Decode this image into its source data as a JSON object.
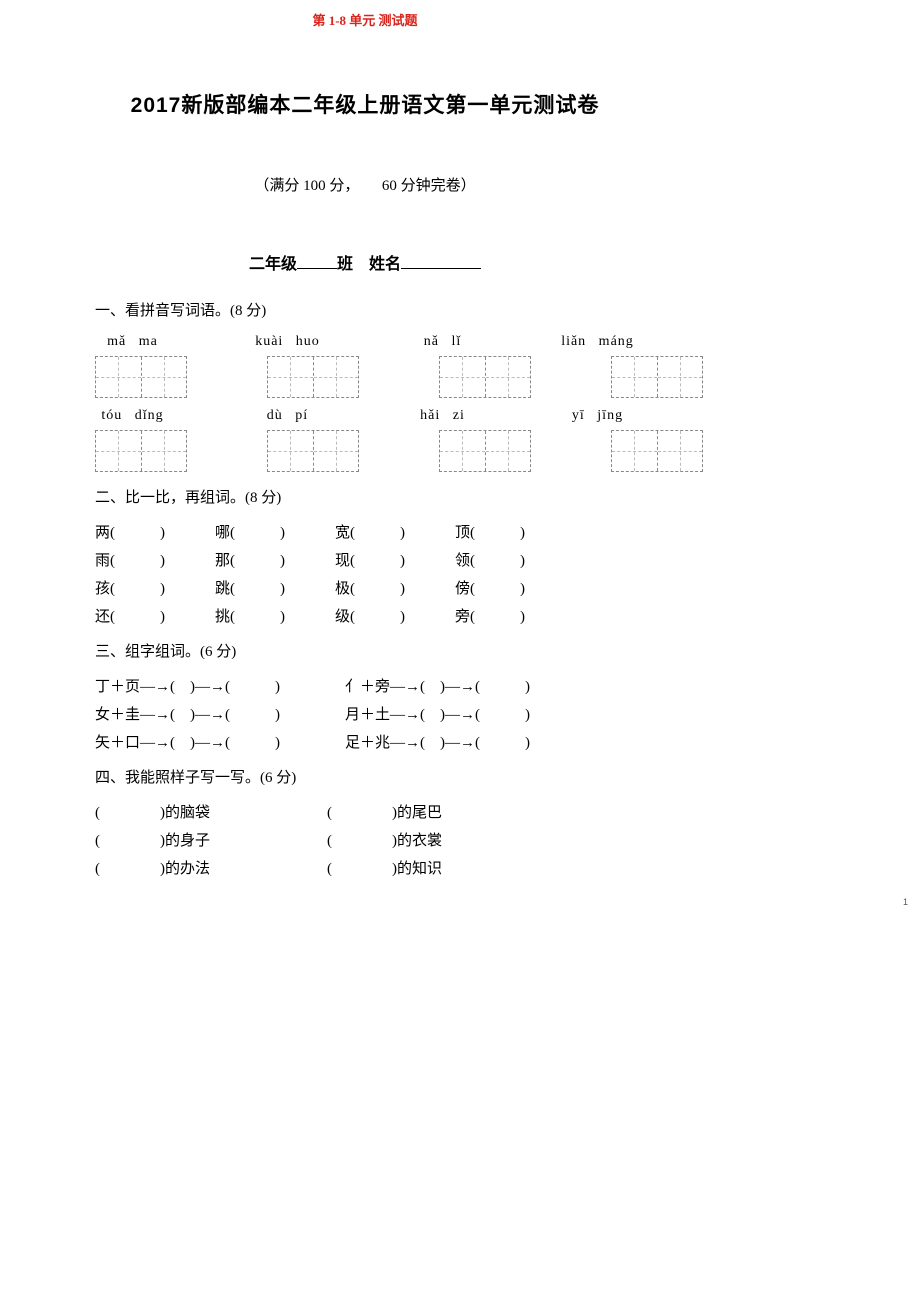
{
  "header_note": "第 1-8 单元 测试题",
  "title": "2017新版部编本二年级上册语文第一单元测试卷",
  "subtitle_left": "（满分 100 分，",
  "subtitle_right": "60 分钟完卷）",
  "name_line": {
    "part1": "二年级",
    "part2": "班　姓名"
  },
  "sections": {
    "s1": "一、看拼音写词语。(8 分)",
    "s2": "二、比一比，再组词。(8 分)",
    "s3": "三、组字组词。(6 分)",
    "s4": "四、我能照样子写一写。(6 分)"
  },
  "pinyin_rows": [
    [
      "mǎ ma",
      "kuài huo",
      "nǎ   lǐ",
      "liǎn máng"
    ],
    [
      "tóu dǐng",
      "dù   pí",
      "hǎi   zi",
      "yī   jīng"
    ]
  ],
  "compare_rows": [
    [
      "两(　　　)",
      "哪(　　　)",
      "宽(　　　)",
      "顶(　　　)"
    ],
    [
      "雨(　　　)",
      "那(　　　)",
      "现(　　　)",
      "领(　　　)"
    ],
    [
      "孩(　　　)",
      "跳(　　　)",
      "极(　　　)",
      "傍(　　　)"
    ],
    [
      "还(　　　)",
      "挑(　　　)",
      "级(　　　)",
      "旁(　　　)"
    ]
  ],
  "compose_rows": [
    {
      "left": "丁＋页—→(　)—→(　　　)",
      "right": "亻＋旁—→(　)—→(　　　)"
    },
    {
      "left": "女＋圭—→(　)—→(　　　)",
      "right": "月＋土—→(　)—→(　　　)"
    },
    {
      "left": "矢＋口—→(　)—→(　　　)",
      "right": "足＋兆—→(　)—→(　　　)"
    }
  ],
  "s4_rows": [
    {
      "left_tail": ")的脑袋",
      "right_tail": ")的尾巴"
    },
    {
      "left_tail": ")的身子",
      "right_tail": ")的衣裳"
    },
    {
      "left_tail": ")的办法",
      "right_tail": ")的知识"
    }
  ],
  "page_number": "1"
}
